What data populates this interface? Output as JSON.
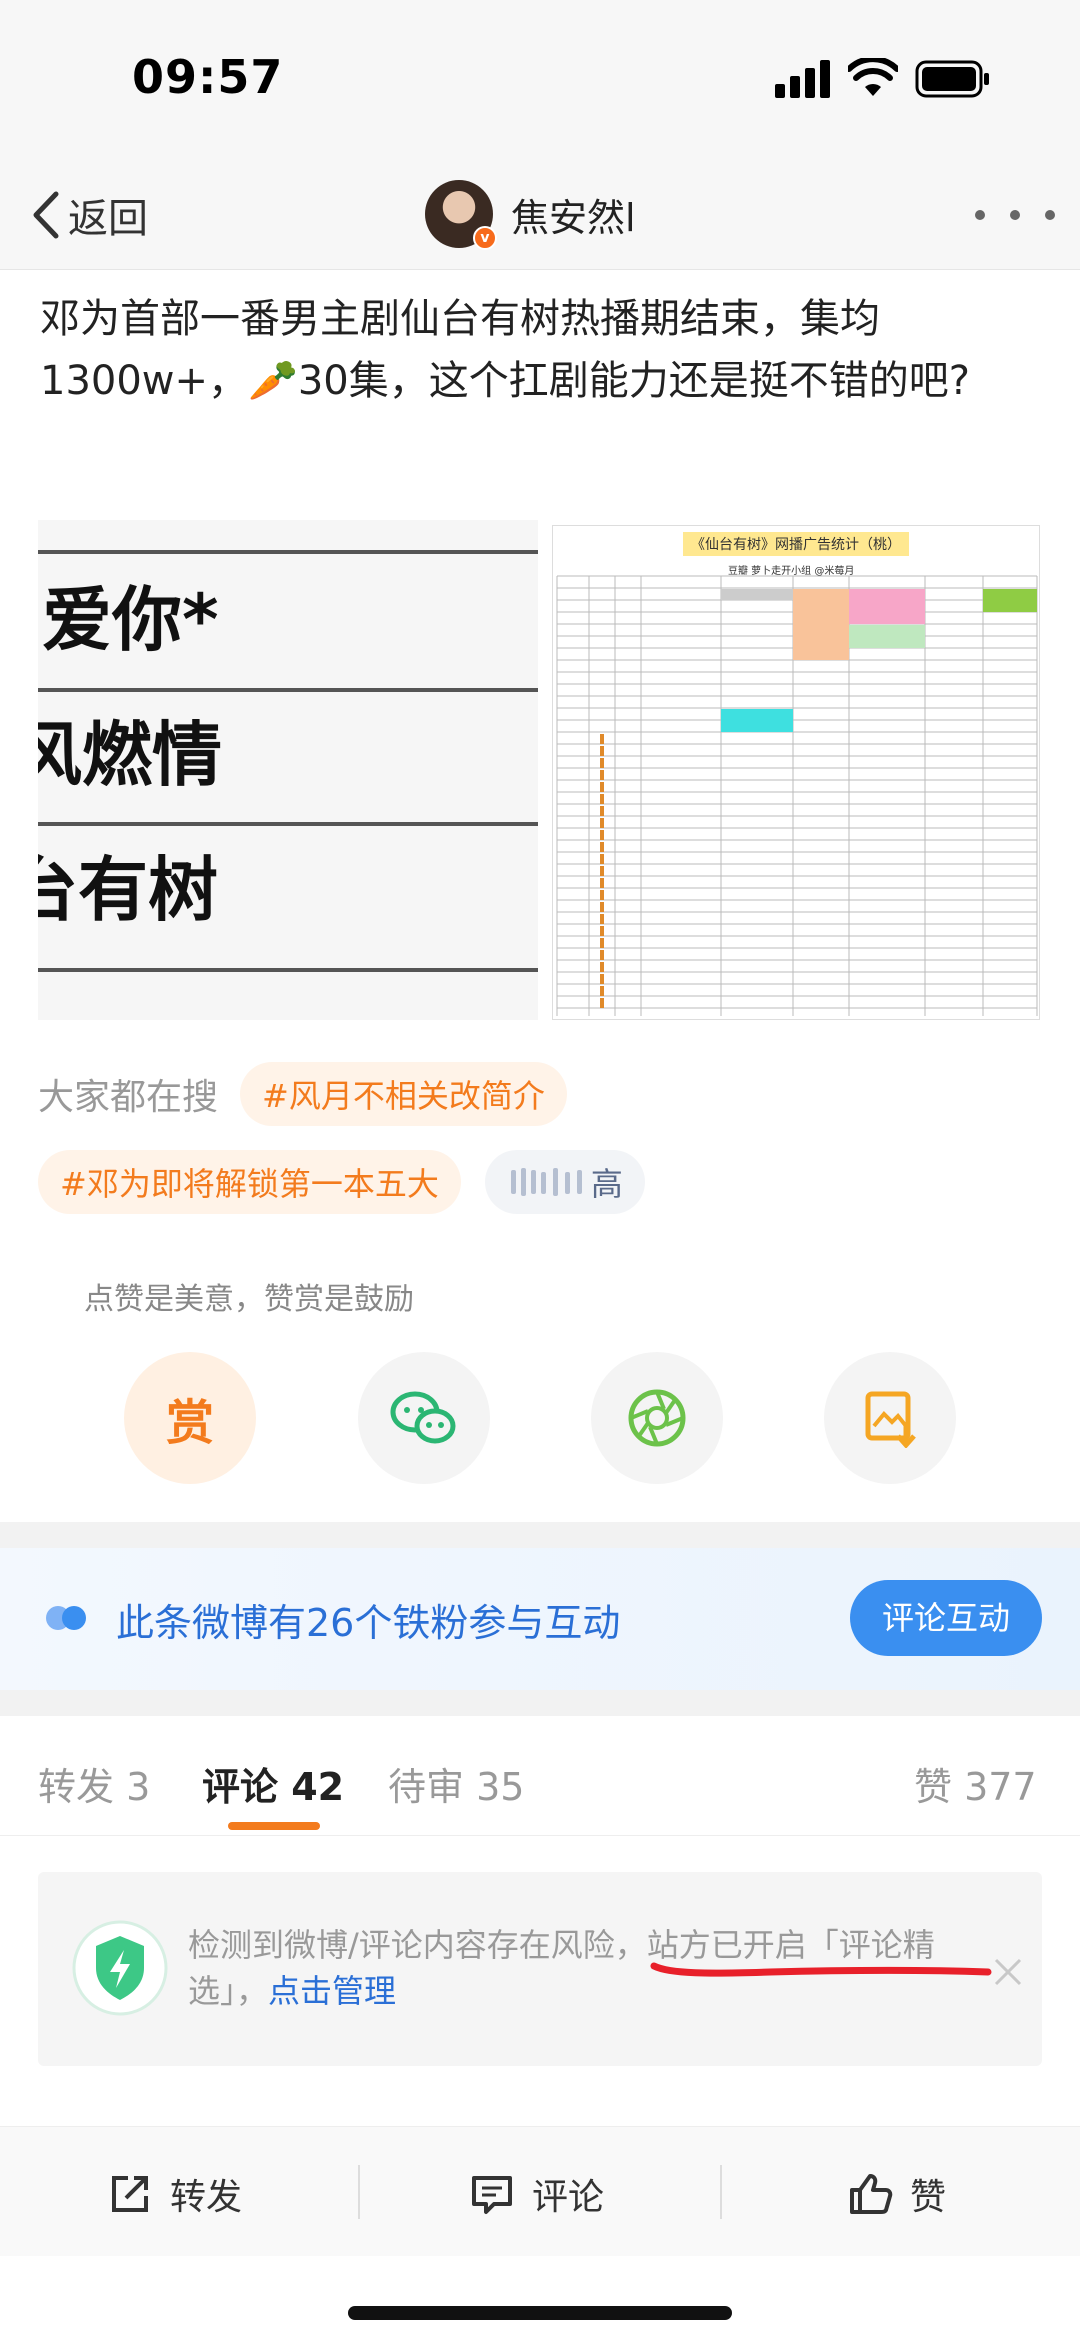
{
  "status_bar": {
    "time": "09:57",
    "icons": [
      "signal-icon",
      "wifi-icon",
      "battery-icon"
    ]
  },
  "nav": {
    "back_label": "返回",
    "username": "焦安然l",
    "verified_badge": "v",
    "more_icon": "more-dots-icon"
  },
  "post": {
    "text_before_emoji": "邓为首部一番男主剧仙台有树热播期结束，集均1300w+，",
    "emoji": "🥕",
    "text_after_emoji": "30集，这个扛剧能力还是挺不错的吧?",
    "image_left_rows": [
      "爱你*",
      "风燃情",
      "台有树"
    ],
    "image_right_title": "《仙台有树》网播广告统计（桃）",
    "image_right_subtitle": "豆瓣 萝卜走开小组 @米莓月"
  },
  "search": {
    "label": "大家都在搜",
    "chips": [
      "#风月不相关改简介",
      "#邓为即将解锁第一本五大",
      "高"
    ]
  },
  "reward": {
    "hint": "点赞是美意，赞赏是鼓励",
    "reward_label": "赏",
    "icons": [
      "wechat-icon",
      "moments-icon",
      "save-image-icon"
    ]
  },
  "fans_banner": {
    "text": "此条微博有26个铁粉参与互动",
    "button": "评论互动"
  },
  "tabs": {
    "repost": "转发 3",
    "comment": "评论 42",
    "pending": "待审 35",
    "like": "赞 377"
  },
  "notice": {
    "text": "检测到微博/评论内容存在风险，站方已开启「评论精选」，",
    "link": "点击管理"
  },
  "bottom_bar": {
    "repost": "转发",
    "comment": "评论",
    "like": "赞"
  },
  "colors": {
    "accent_orange": "#f37b1d",
    "link_blue": "#2a6fd6",
    "button_blue": "#3a8ff0",
    "annotation_red": "#e8202a"
  }
}
